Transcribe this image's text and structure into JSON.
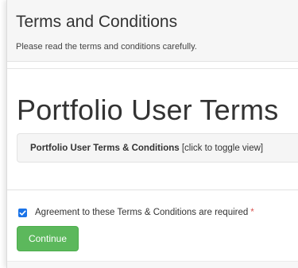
{
  "header": {
    "title": "Terms and Conditions",
    "subtitle": "Please read the terms and conditions carefully."
  },
  "main": {
    "heading": "Portfolio User Terms",
    "toggle": {
      "title": "Portfolio User Terms & Conditions",
      "hint": "[click to toggle view]"
    }
  },
  "agreement": {
    "checked": true,
    "label": "Agreement to these Terms & Conditions are required",
    "required_marker": "*"
  },
  "actions": {
    "continue_label": "Continue"
  },
  "colors": {
    "accent_blue": "#1a73e8",
    "button_green": "#5cb85c",
    "required_red": "#d9534f"
  }
}
